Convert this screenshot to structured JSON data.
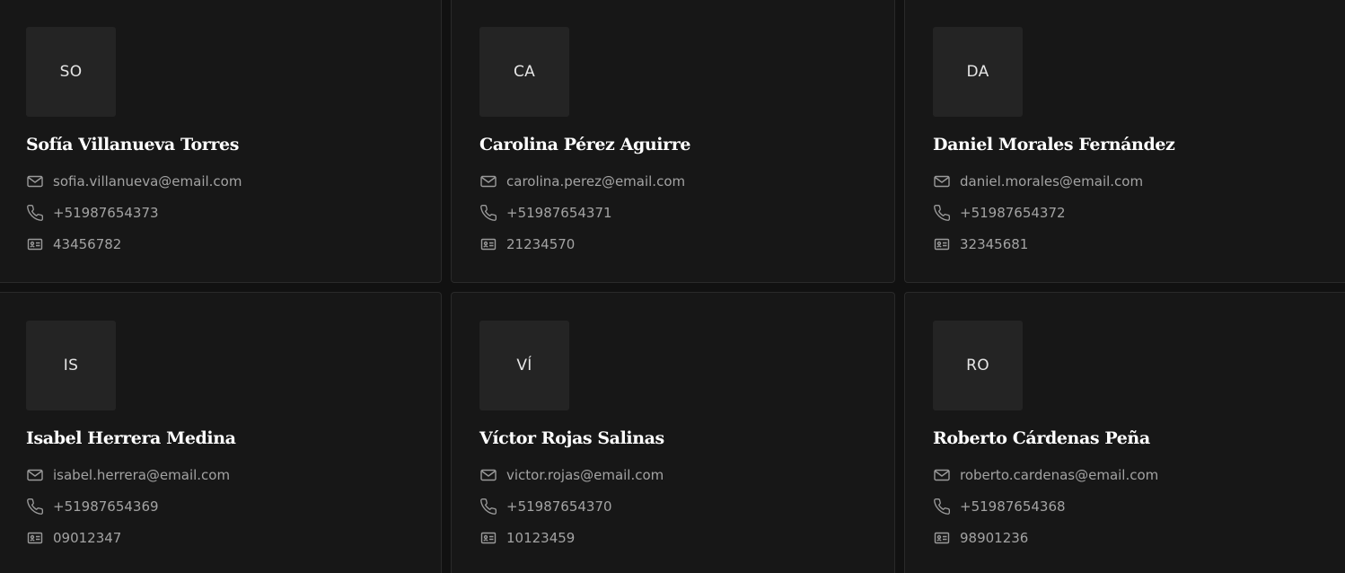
{
  "contacts": [
    {
      "initials": "SO",
      "name": "Sofía Villanueva Torres",
      "email": "sofia.villanueva@email.com",
      "phone": "+51987654373",
      "document": "43456782",
      "email_icon": "mail-icon",
      "phone_icon": "phone-icon",
      "document_icon": "id-card-icon"
    },
    {
      "initials": "CA",
      "name": "Carolina Pérez Aguirre",
      "email": "carolina.perez@email.com",
      "phone": "+51987654371",
      "document": "21234570",
      "email_icon": "mail-icon",
      "phone_icon": "phone-icon",
      "document_icon": "id-card-icon"
    },
    {
      "initials": "DA",
      "name": "Daniel Morales Fernández",
      "email": "daniel.morales@email.com",
      "phone": "+51987654372",
      "document": "32345681",
      "email_icon": "mail-icon",
      "phone_icon": "phone-icon",
      "document_icon": "id-card-icon"
    },
    {
      "initials": "IS",
      "name": "Isabel Herrera Medina",
      "email": "isabel.herrera@email.com",
      "phone": "+51987654369",
      "document": "09012347",
      "email_icon": "mail-icon",
      "phone_icon": "phone-icon",
      "document_icon": "id-card-icon"
    },
    {
      "initials": "VÍ",
      "name": "Víctor Rojas Salinas",
      "email": "victor.rojas@email.com",
      "phone": "+51987654370",
      "document": "10123459",
      "email_icon": "mail-icon",
      "phone_icon": "phone-icon",
      "document_icon": "id-card-icon"
    },
    {
      "initials": "RO",
      "name": "Roberto Cárdenas Peña",
      "email": "roberto.cardenas@email.com",
      "phone": "+51987654368",
      "document": "98901236",
      "email_icon": "mail-icon",
      "phone_icon": "phone-icon",
      "document_icon": "id-card-icon"
    }
  ],
  "colors": {
    "page_background": "#111111",
    "card_background": "#171717",
    "avatar_background": "#242424",
    "name_text": "#ffffff",
    "detail_text": "#a3a3a3",
    "icon_stroke": "#9a9a9a"
  }
}
